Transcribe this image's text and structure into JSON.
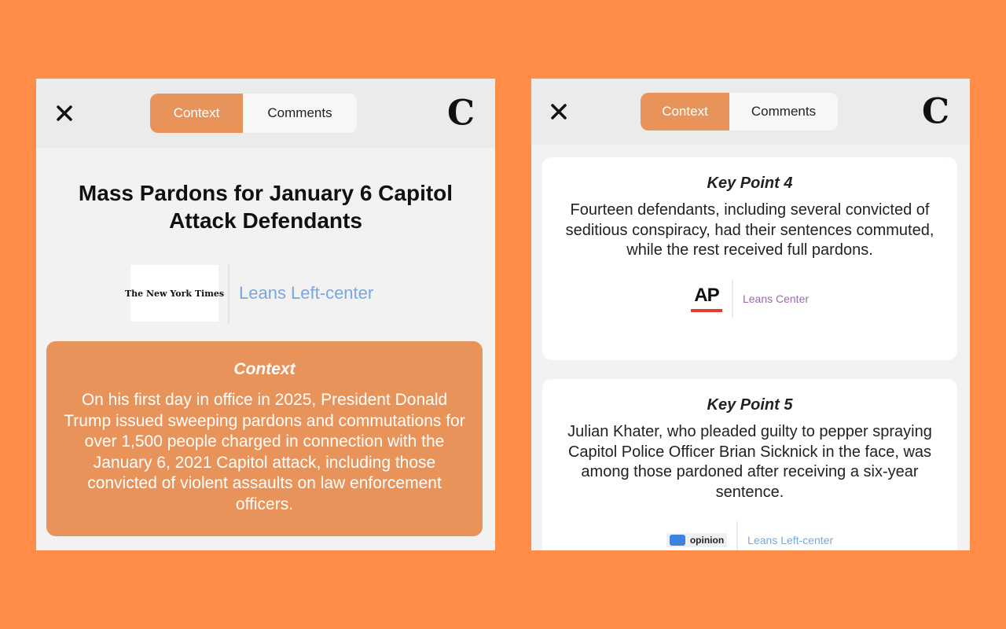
{
  "left_panel": {
    "tabs": [
      {
        "label": "Context"
      },
      {
        "label": "Comments"
      }
    ],
    "logo_letter": "C",
    "headline": "Mass Pardons for January 6 Capitol Attack Defendants",
    "source": {
      "name": "The New York Times",
      "bias": "Leans Left-center"
    },
    "context": {
      "title": "Context",
      "body": "On his first day in office in 2025, President Donald Trump issued sweeping pardons and commutations for over 1,500 people charged in connection with the January 6, 2021 Capitol attack, including those convicted of violent assaults on law enforcement officers."
    }
  },
  "right_panel": {
    "tabs": [
      {
        "label": "Context"
      },
      {
        "label": "Comments"
      }
    ],
    "logo_letter": "C",
    "key_points": [
      {
        "title": "Key Point 4",
        "body": "Fourteen defendants, including several convicted of seditious conspiracy, had their sentences commuted, while the rest received full pardons.",
        "source_logo": "AP",
        "bias": "Leans Center"
      },
      {
        "title": "Key Point 5",
        "body": "Julian Khater, who pleaded guilty to pepper spraying Capitol Police Officer Brian Sicknick in the face, was among those pardoned after receiving a six-year sentence.",
        "source_logo": "opinion",
        "bias": "Leans Left-center"
      }
    ]
  },
  "colors": {
    "background": "#ff8c47",
    "accent": "#e8935a",
    "bias_center": "#9b6aa8",
    "bias_left_center": "#7aa7de"
  }
}
